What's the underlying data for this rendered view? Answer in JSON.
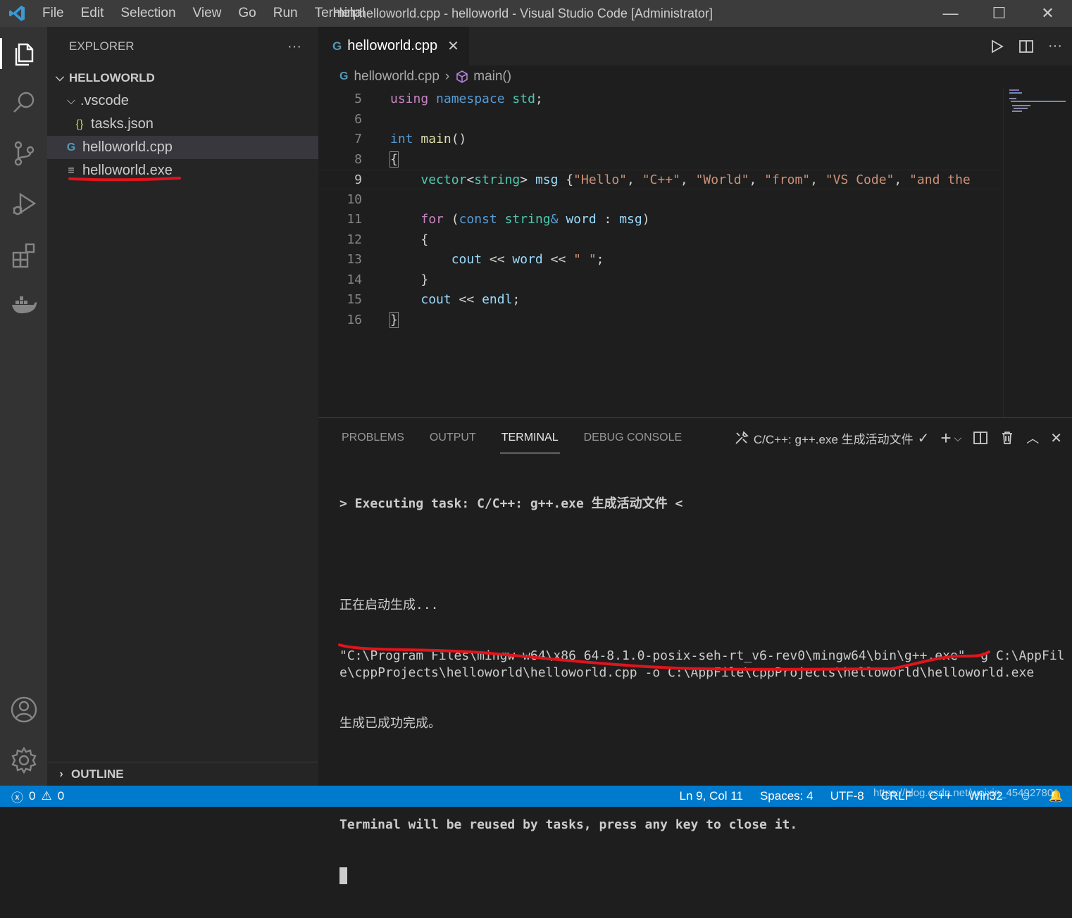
{
  "titlebar": {
    "menu": [
      "File",
      "Edit",
      "Selection",
      "View",
      "Go",
      "Run",
      "Terminal",
      "Help"
    ],
    "window_title": "helloworld.cpp - helloworld - Visual Studio Code [Administrator]",
    "minimize": "—",
    "maximize": "☐",
    "close": "✕"
  },
  "sidebar": {
    "title": "EXPLORER",
    "more": "···",
    "root": "HELLOWORLD",
    "items": [
      {
        "label": ".vscode",
        "type": "folder"
      },
      {
        "label": "tasks.json",
        "type": "json",
        "icon": "{}"
      },
      {
        "label": "helloworld.cpp",
        "type": "cpp",
        "icon": "G"
      },
      {
        "label": "helloworld.exe",
        "type": "exe",
        "icon": "≡"
      }
    ],
    "outline": "OUTLINE"
  },
  "editor": {
    "tab_label": "helloworld.cpp",
    "breadcrumb_file": "helloworld.cpp",
    "breadcrumb_symbol": "main()",
    "line_numbers": [
      "5",
      "6",
      "7",
      "8",
      "9",
      "10",
      "11",
      "12",
      "13",
      "14",
      "15",
      "16"
    ]
  },
  "panel": {
    "tabs": [
      "PROBLEMS",
      "OUTPUT",
      "TERMINAL",
      "DEBUG CONSOLE"
    ],
    "active_tab": "TERMINAL",
    "task_selector": "C/C++: g++.exe 生成活动文件",
    "terminal": {
      "line1": "> Executing task: C/C++: g++.exe 生成活动文件 <",
      "line2": "正在启动生成...",
      "line3": "\"C:\\Program Files\\mingw-w64\\x86_64-8.1.0-posix-seh-rt_v6-rev0\\mingw64\\bin\\g++.exe\" -g C:\\AppFile\\cppProjects\\helloworld\\helloworld.cpp -o C:\\AppFile\\cppProjects\\helloworld\\helloworld.exe",
      "line4": "生成已成功完成。",
      "line5": "Terminal will be reused by tasks, press any key to close it."
    }
  },
  "statusbar": {
    "errors": "0",
    "warnings": "0",
    "position": "Ln 9, Col 11",
    "spaces": "Spaces: 4",
    "encoding": "UTF-8",
    "eol": "CRLF",
    "language": "C++",
    "platform": "Win32",
    "watermark": "https://blog.csdn.net/weixin_45492780"
  },
  "colors": {
    "accent": "#007acc",
    "annotation": "#e0141c"
  }
}
